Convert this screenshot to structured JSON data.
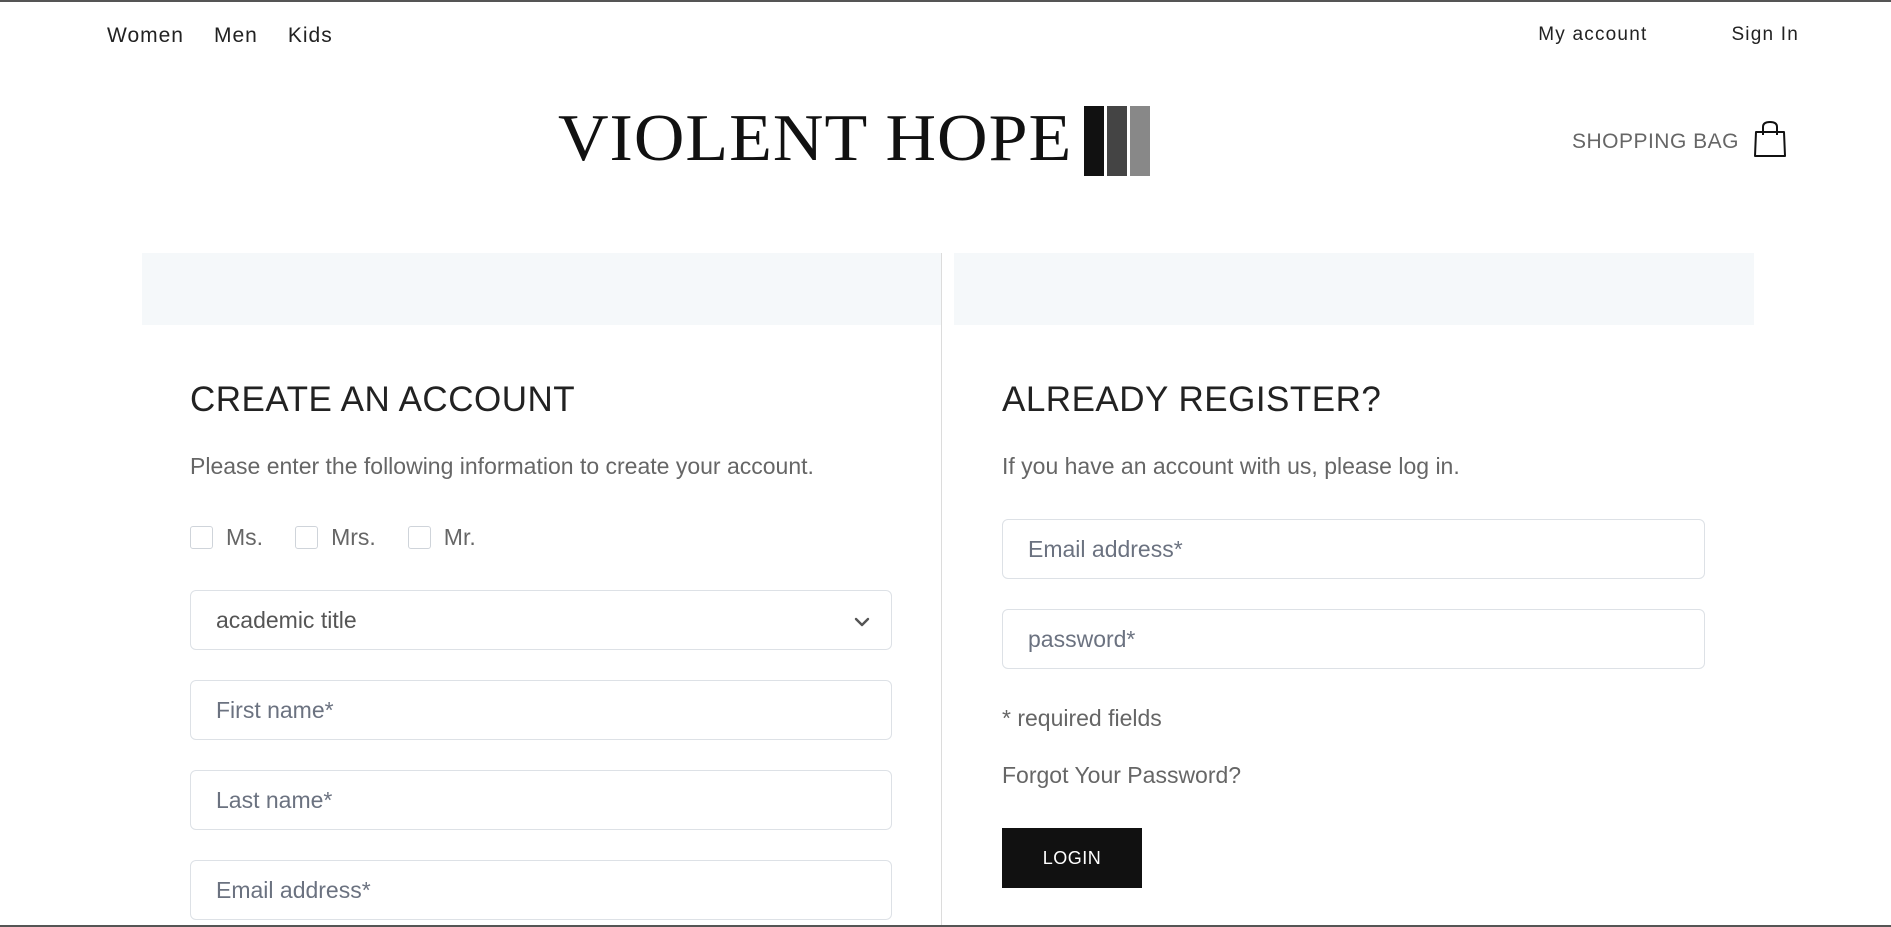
{
  "nav": {
    "left": [
      "Women",
      "Men",
      "Kids"
    ],
    "my_account": "My account",
    "sign_in": "Sign In"
  },
  "logo": {
    "text": "VIOLENT HOPE",
    "bar_colors": [
      "#111111",
      "#444444",
      "#888888"
    ]
  },
  "cart": {
    "label": "SHOPPING BAG",
    "icon": "shopping-bag-icon"
  },
  "create": {
    "title": "CREATE AN ACCOUNT",
    "description": "Please enter the following information to create your account.",
    "salutations": [
      "Ms.",
      "Mrs.",
      "Mr."
    ],
    "academic_title": "academic title",
    "first_name_placeholder": "First name*",
    "last_name_placeholder": "Last name*",
    "email_placeholder": "Email address*"
  },
  "login": {
    "title": "ALREADY REGISTER?",
    "description": "If you have an account with us, please log in.",
    "email_placeholder": "Email address*",
    "password_placeholder": "password*",
    "required_note": "* required fields",
    "forgot": "Forgot Your Password?",
    "button": "LOGIN"
  },
  "colors": {
    "panel_header_bg": "#f5f8fa",
    "button_bg": "#111111",
    "muted_text": "#666666"
  }
}
